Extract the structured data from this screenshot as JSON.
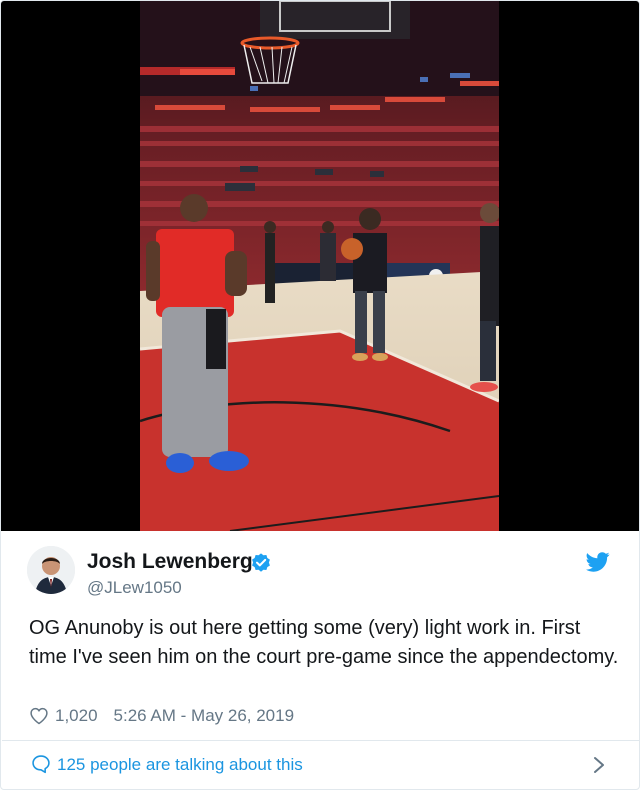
{
  "author": {
    "name": "Josh Lewenberg",
    "handle": "@JLew1050",
    "verified": true
  },
  "tweet": {
    "text": "OG Anunoby is out here getting some (very) light work in. First time I've seen him on the court pre-game since the appendectomy.",
    "likes": "1,020",
    "timestamp": "5:26 AM - May 26, 2019"
  },
  "footer": {
    "talking_label": "125 people are talking about this"
  },
  "icons": {
    "verified": "verified-badge-icon",
    "platform": "twitter-bird-icon",
    "like": "heart-icon",
    "reply": "speech-bubble-icon",
    "chevron": "chevron-right-icon"
  },
  "colors": {
    "accent": "#1da1f2",
    "link": "#1b95e0",
    "text": "#14171a",
    "secondary": "#657786"
  }
}
